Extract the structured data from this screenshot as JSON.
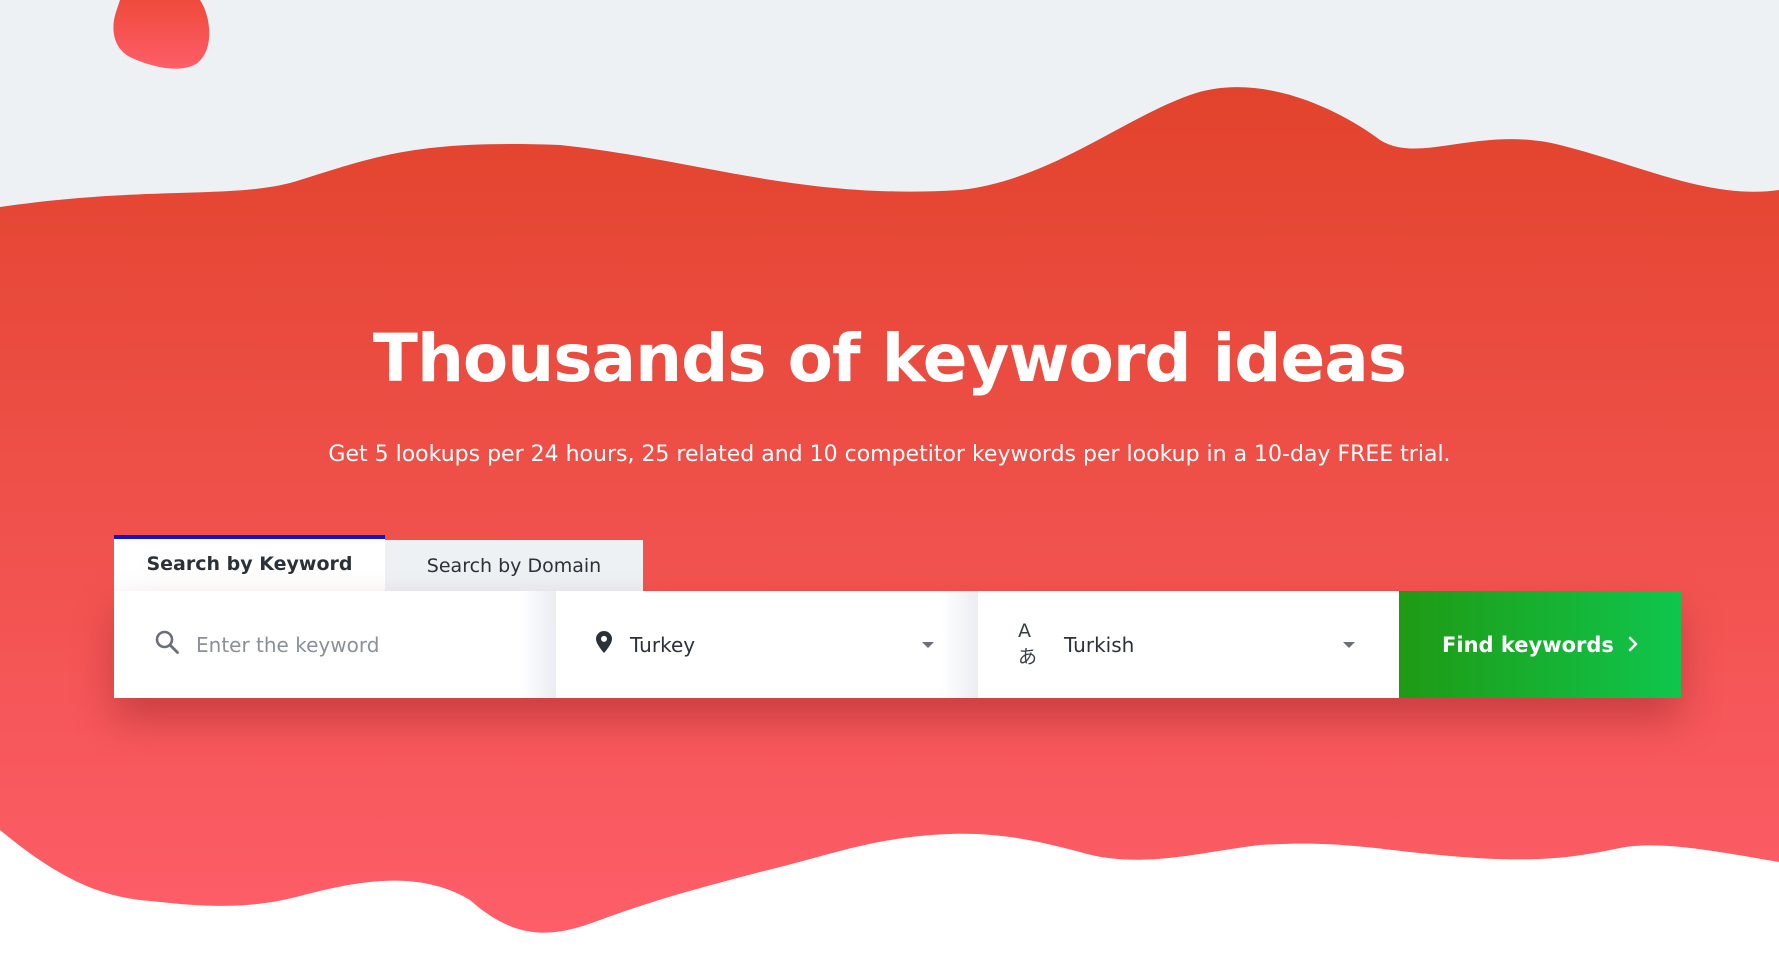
{
  "hero": {
    "title": "Thousands of keyword ideas",
    "subtitle": "Get 5 lookups per 24 hours, 25 related and 10 competitor keywords per lookup in a 10-day FREE trial."
  },
  "tabs": [
    {
      "label": "Search by Keyword",
      "active": true
    },
    {
      "label": "Search by Domain",
      "active": false
    }
  ],
  "search": {
    "keyword_placeholder": "Enter the keyword",
    "keyword_value": "",
    "location": "Turkey",
    "language": "Turkish",
    "submit_label": "Find keywords"
  },
  "icons": {
    "search": "search-icon",
    "location": "map-pin-icon",
    "language": "translate-icon",
    "dropdown": "caret-down-icon",
    "submit": "chevron-right-icon"
  },
  "colors": {
    "background": "#eef1f4",
    "blob_top": "#e2432c",
    "blob_bottom": "#fd5e69",
    "active_tab_border": "#1214cc",
    "button_start": "#1f9a14",
    "button_end": "#0fc64d",
    "text_dark": "#2b3138"
  }
}
